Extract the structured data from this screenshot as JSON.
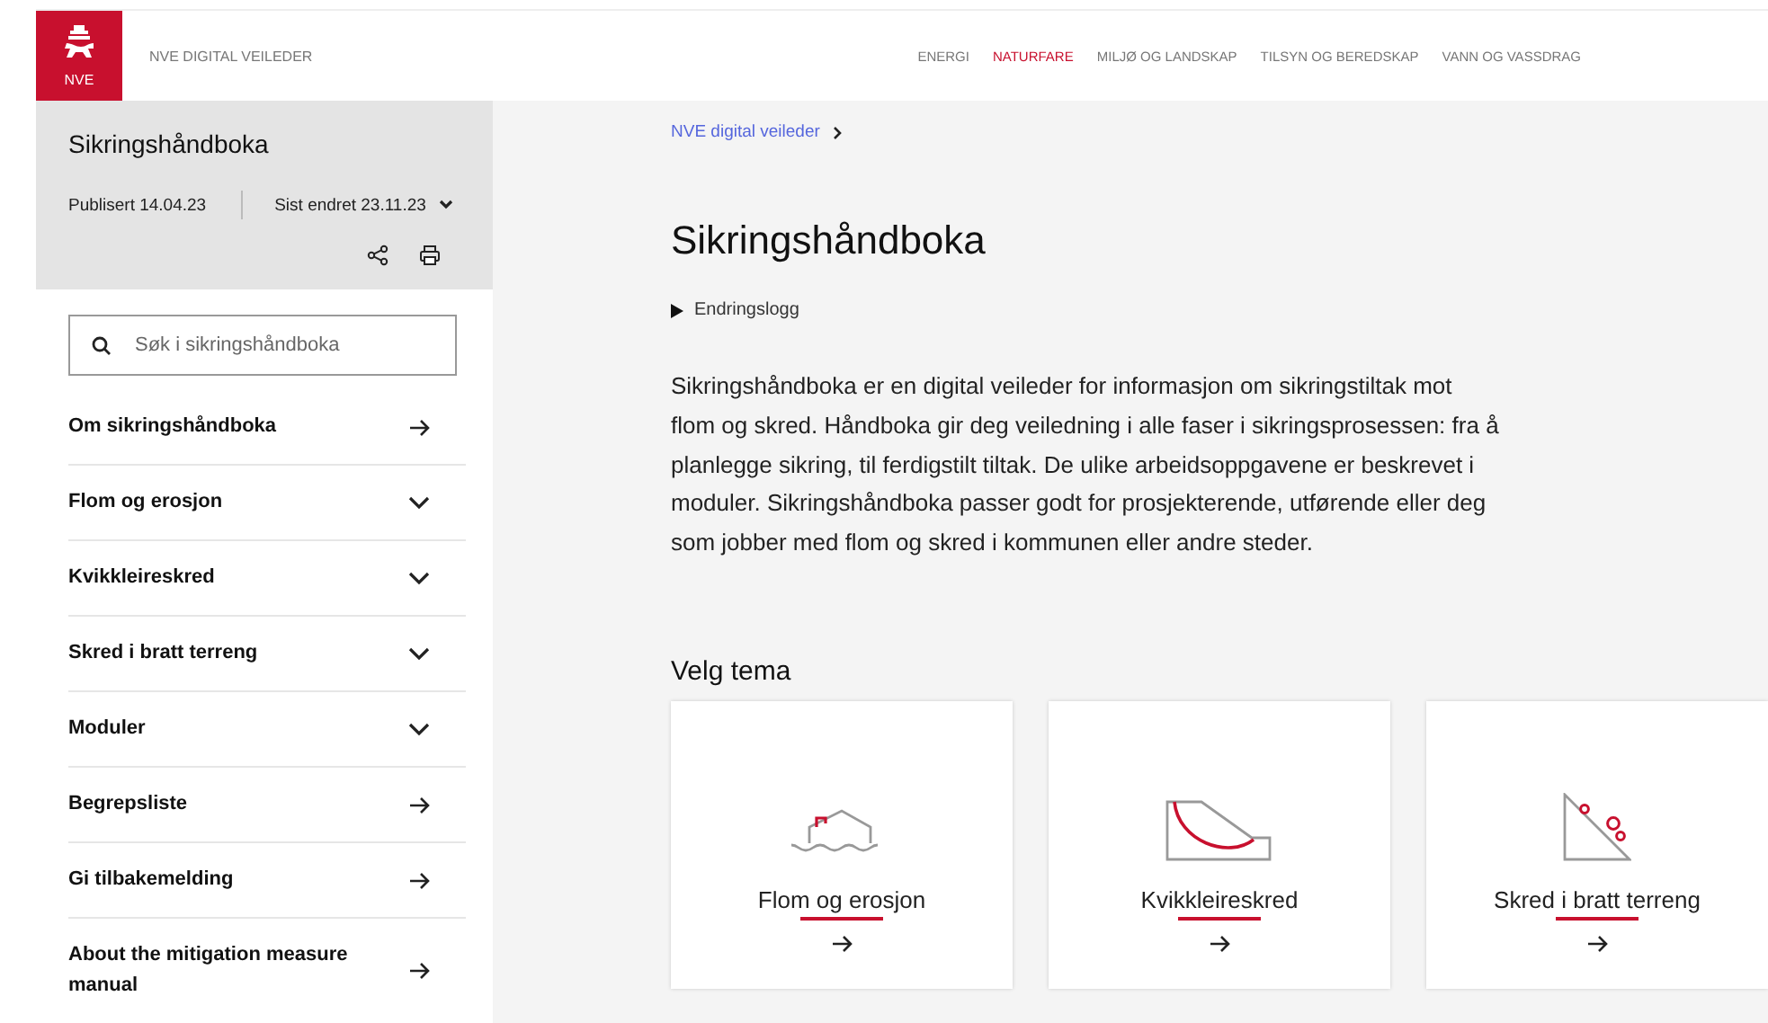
{
  "header": {
    "logo_text": "NVE",
    "site_title": "NVE DIGITAL VEILEDER",
    "nav": [
      {
        "label": "ENERGI",
        "selected": false
      },
      {
        "label": "NATURFARE",
        "selected": true
      },
      {
        "label": "MILJØ OG LANDSKAP",
        "selected": false
      },
      {
        "label": "TILSYN OG BEREDSKAP",
        "selected": false
      },
      {
        "label": "VANN OG VASSDRAG",
        "selected": false
      }
    ]
  },
  "sidebar": {
    "title": "Sikringshåndboka",
    "published": "Publisert 14.04.23",
    "changed": "Sist endret 23.11.23",
    "search": {
      "placeholder": "Søk i sikringshåndboka"
    },
    "items": [
      {
        "label": "Om sikringshåndboka",
        "kind": "link"
      },
      {
        "label": "Flom og erosjon",
        "kind": "expand"
      },
      {
        "label": "Kvikkleireskred",
        "kind": "expand"
      },
      {
        "label": "Skred i bratt terreng",
        "kind": "expand"
      },
      {
        "label": "Moduler",
        "kind": "expand"
      },
      {
        "label": "Begrepsliste",
        "kind": "link"
      },
      {
        "label": "Gi tilbakemelding",
        "kind": "link"
      },
      {
        "label": "About the mitigation measure manual",
        "kind": "link"
      }
    ]
  },
  "main": {
    "breadcrumb": "NVE digital veileder",
    "title": "Sikringshåndboka",
    "changelog": "Endringslogg",
    "intro": "Sikringshåndboka er en digital veileder for informasjon om sikringstiltak mot flom og skred. Håndboka gir deg veiledning i alle faser i sikringsprosessen: fra å planlegge sikring, til ferdigstilt tiltak. De ulike arbeidsoppgavene er beskrevet i moduler. Sikringshåndboka passer godt for prosjekterende, utførende eller deg som jobber med flom og skred i kommunen eller andre steder.",
    "section_title": "Velg tema",
    "cards": [
      {
        "label": "Flom og erosjon",
        "kind": "flood"
      },
      {
        "label": "Kvikkleireskred",
        "kind": "quickclay"
      },
      {
        "label": "Skred i bratt terreng",
        "kind": "rockfall"
      }
    ]
  }
}
